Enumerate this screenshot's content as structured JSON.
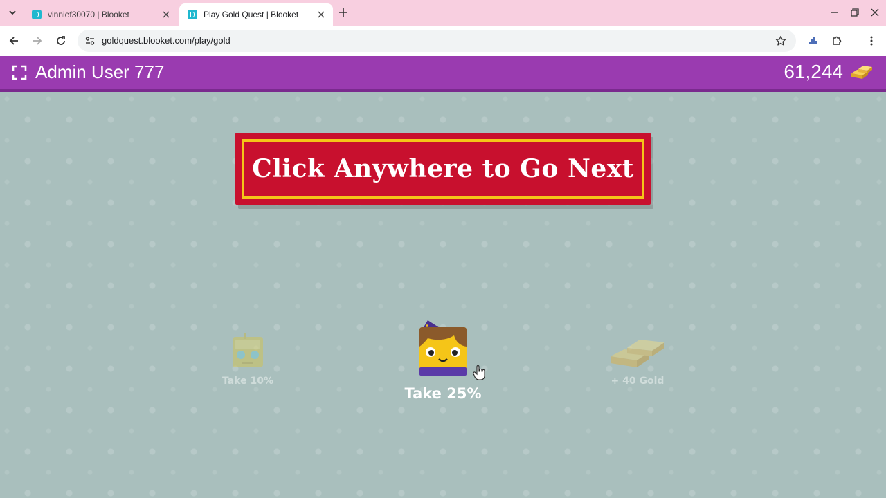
{
  "browser": {
    "tabs": [
      {
        "title": "vinnief30070 | Blooket",
        "active": false
      },
      {
        "title": "Play Gold Quest | Blooket",
        "active": true
      }
    ],
    "url": "goldquest.blooket.com/play/gold"
  },
  "game": {
    "player_name": "Admin User 777",
    "gold": "61,244",
    "banner": "Click Anywhere to Go Next",
    "choices": [
      {
        "label": "Take 10%",
        "icon": "robot-blook-icon",
        "selected": false
      },
      {
        "label": "Take 25%",
        "icon": "witch-blook-icon",
        "selected": true
      },
      {
        "label": "+ 40 Gold",
        "icon": "gold-bars-icon",
        "selected": false
      }
    ]
  },
  "colors": {
    "tabstrip": "#f8cfe0",
    "header": "#9a3bb0",
    "game_bg": "#a9bfbd",
    "banner_red": "#c8102e",
    "banner_border": "#f5c518"
  }
}
